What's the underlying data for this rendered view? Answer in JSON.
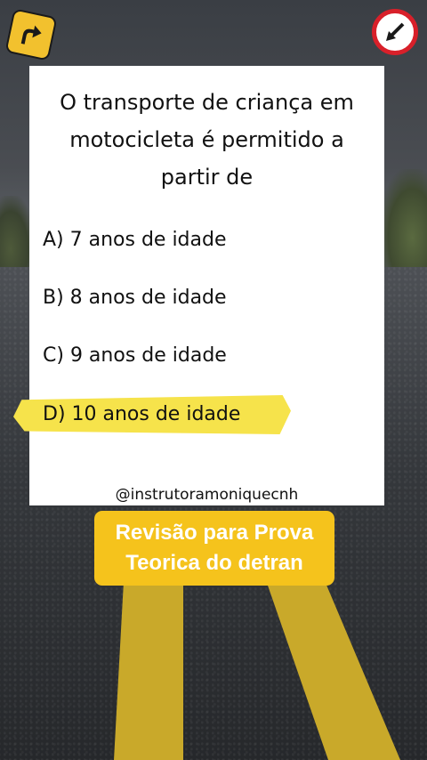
{
  "signs": {
    "left_icon": "curve-right-sign-icon",
    "right_icon": "arrow-down-left-sign-icon",
    "sign_yellow": "#f2c12e",
    "sign_red": "#d8202a"
  },
  "card": {
    "question": "O transporte de criança em motocicleta é permitido a partir de",
    "options": [
      {
        "label": "A) 7 anos de idade",
        "highlighted": false
      },
      {
        "label": "B) 8 anos de idade",
        "highlighted": false
      },
      {
        "label": "C) 9 anos de idade",
        "highlighted": false
      },
      {
        "label": "D) 10 anos de idade",
        "highlighted": true
      }
    ],
    "highlight_color": "#f6e34b",
    "handle": "@instrutoramoniquecnh"
  },
  "banner": {
    "line1": "Revisão para Prova",
    "line2": "Teorica do detran",
    "color": "#f5c31c"
  }
}
